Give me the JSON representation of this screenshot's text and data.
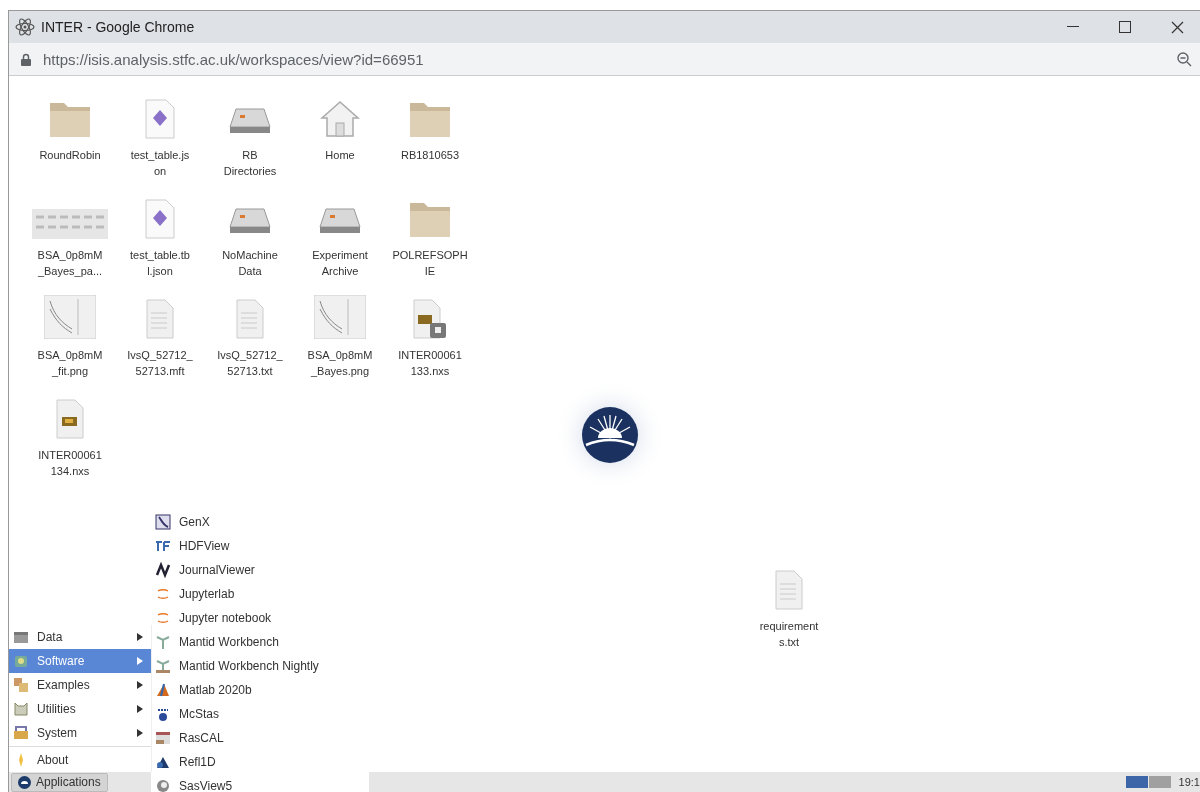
{
  "window": {
    "title": "INTER - Google Chrome",
    "url": "https://isis.analysis.stfc.ac.uk/workspaces/view?id=66951"
  },
  "desktop": {
    "icons": [
      {
        "kind": "folder",
        "label": "RoundRobin"
      },
      {
        "kind": "json",
        "label": "test_table.js on"
      },
      {
        "kind": "drive",
        "label": "RB Directories"
      },
      {
        "kind": "home",
        "label": "Home"
      },
      {
        "kind": "folder",
        "label": "RB1810653"
      },
      {
        "kind": "thumbnail",
        "label": "BSA_0p8mM _Bayes_pa..."
      },
      {
        "kind": "json",
        "label": "test_table.tb l.json"
      },
      {
        "kind": "drive",
        "label": "NoMachine Data"
      },
      {
        "kind": "drive",
        "label": "Experiment Archive"
      },
      {
        "kind": "folder",
        "label": "POLREFSOPH IE"
      },
      {
        "kind": "plot",
        "label": "BSA_0p8mM _fit.png"
      },
      {
        "kind": "text",
        "label": "IvsQ_52712_ 52713.mft"
      },
      {
        "kind": "text",
        "label": "IvsQ_52712_ 52713.txt"
      },
      {
        "kind": "plot",
        "label": "BSA_0p8mM _Bayes.png"
      },
      {
        "kind": "locked-data",
        "label": "INTER00061 133.nxs"
      },
      {
        "kind": "data",
        "label": "INTER00061 134.nxs"
      }
    ],
    "loose_icons": [
      {
        "kind": "text",
        "label": "requirement s.txt"
      }
    ]
  },
  "menu": {
    "items": [
      {
        "label": "Data",
        "has_submenu": true,
        "selected": false
      },
      {
        "label": "Software",
        "has_submenu": true,
        "selected": true
      },
      {
        "label": "Examples",
        "has_submenu": true,
        "selected": false
      },
      {
        "label": "Utilities",
        "has_submenu": true,
        "selected": false
      },
      {
        "label": "System",
        "has_submenu": true,
        "selected": false
      },
      {
        "label": "About",
        "has_submenu": false,
        "selected": false
      }
    ],
    "submenu": [
      "GenX",
      "HDFView",
      "JournalViewer",
      "Jupyterlab",
      "Jupyter notebook",
      "Mantid Workbench",
      "Mantid Workbench Nightly",
      "Matlab 2020b",
      "McStas",
      "RasCAL",
      "Refl1D",
      "SasView5"
    ]
  },
  "taskbar": {
    "applications": "Applications",
    "workspaces": [
      {
        "selected": true
      },
      {
        "selected": false
      }
    ],
    "clock": "19:1"
  }
}
